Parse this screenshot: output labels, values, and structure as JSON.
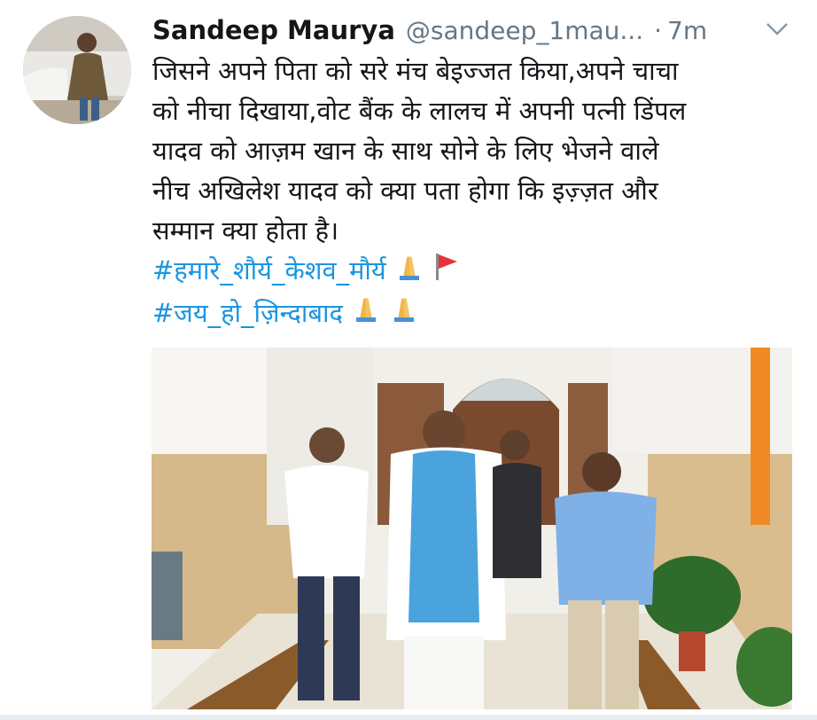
{
  "tweet": {
    "author_name": "Sandeep Maurya",
    "author_handle": "@sandeep_1mau...",
    "separator": "·",
    "timestamp": "7m",
    "text_lines": [
      "जिसने अपने पिता को सरे मंच बेइज्जत किया,अपने चाचा",
      "को नीचा दिखाया,वोट बैंक के लालच में अपनी पत्नी डिंपल",
      "यादव को आज़म खान के साथ सोने के लिए भेजने वाले",
      "नीच अखिलेश यादव को क्या पता होगा कि इज़्ज़त और",
      "सम्मान क्या होता है।"
    ],
    "hashtags": [
      "#हमारे_शौर्य_केशव_मौर्य",
      "#जय_हो_ज़िन्दाबाद"
    ],
    "icons": {
      "menu": "chevron-down-icon",
      "emoji_pray": "folded-hands-icon",
      "emoji_flag": "flag-icon"
    },
    "colors": {
      "hashtag": "#1b95e0",
      "meta": "#657786",
      "text": "#14171a"
    }
  }
}
